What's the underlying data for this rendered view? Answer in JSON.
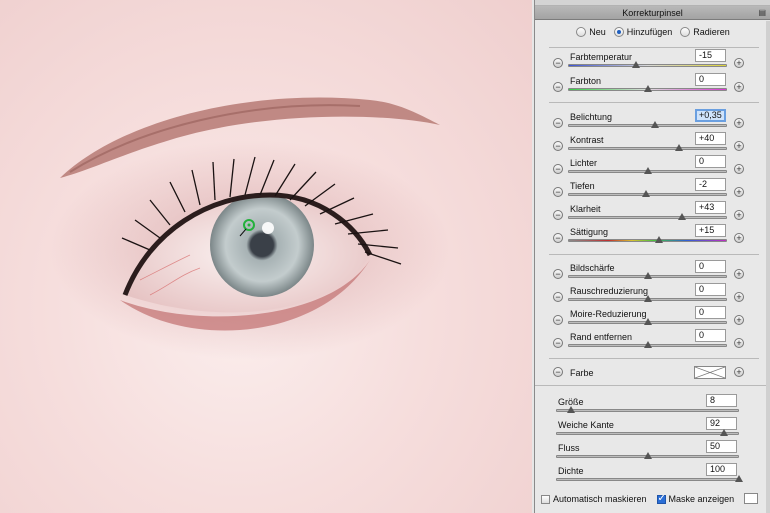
{
  "panel": {
    "title": "Korrekturpinsel",
    "menu_icon": "panel-menu-icon"
  },
  "mode": {
    "options": [
      "Neu",
      "Hinzufügen",
      "Radieren"
    ],
    "selected": "Hinzufügen"
  },
  "sliders": [
    {
      "label": "Farbtemperatur",
      "value": "-15",
      "position": 0.43
    },
    {
      "label": "Farbton",
      "value": "0",
      "position": 0.5
    },
    {
      "label": "Belichtung",
      "value": "+0,35",
      "position": 0.55
    },
    {
      "label": "Kontrast",
      "value": "+40",
      "position": 0.7
    },
    {
      "label": "Lichter",
      "value": "0",
      "position": 0.5
    },
    {
      "label": "Tiefen",
      "value": "-2",
      "position": 0.49
    },
    {
      "label": "Klarheit",
      "value": "+43",
      "position": 0.72
    },
    {
      "label": "Sättigung",
      "value": "+15",
      "position": 0.57
    },
    {
      "label": "Bildschärfe",
      "value": "0",
      "position": 0.5
    },
    {
      "label": "Rauschreduzierung",
      "value": "0",
      "position": 0.5
    },
    {
      "label": "Moire-Reduzierung",
      "value": "0",
      "position": 0.5
    },
    {
      "label": "Rand entfernen",
      "value": "0",
      "position": 0.5
    }
  ],
  "color": {
    "label": "Farbe"
  },
  "brush": [
    {
      "label": "Größe",
      "value": "8",
      "position": 0.08
    },
    {
      "label": "Weiche Kante",
      "value": "92",
      "position": 0.92
    },
    {
      "label": "Fluss",
      "value": "50",
      "position": 0.5
    },
    {
      "label": "Dichte",
      "value": "100",
      "position": 1.0
    }
  ],
  "options": {
    "auto_mask": "Automatisch maskieren",
    "auto_mask_checked": false,
    "show_mask": "Maske anzeigen",
    "show_mask_checked": true
  }
}
